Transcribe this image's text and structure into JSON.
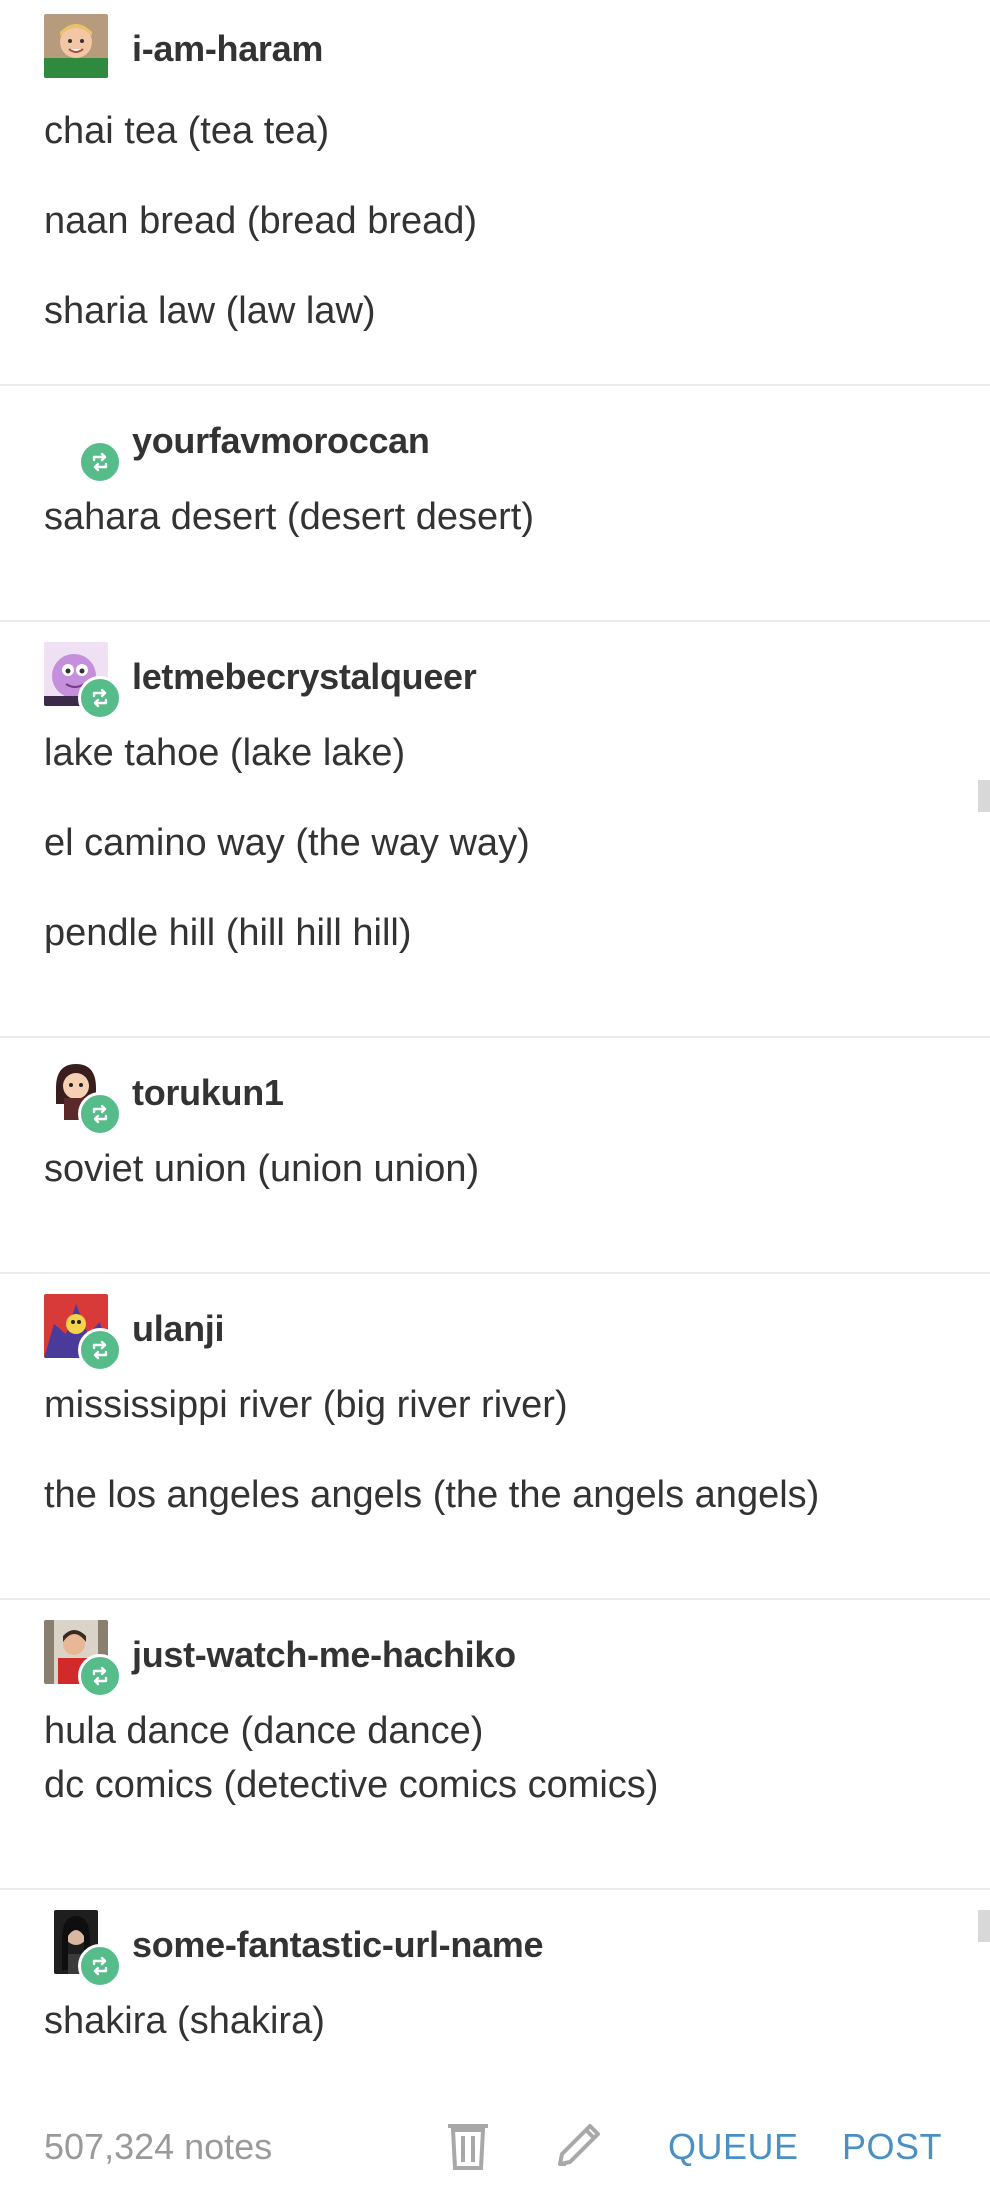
{
  "posts": [
    {
      "username": "i-am-haram",
      "lines": [
        "chai tea (tea tea)",
        "naan bread (bread bread)",
        "sharia law (law law)"
      ]
    },
    {
      "username": "yourfavmoroccan",
      "lines": [
        "sahara desert (desert desert)"
      ]
    },
    {
      "username": "letmebecrystalqueer",
      "lines": [
        "lake tahoe (lake lake)",
        "el camino way (the way way)",
        "pendle hill (hill hill hill)"
      ]
    },
    {
      "username": "torukun1",
      "lines": [
        "soviet union (union union)"
      ]
    },
    {
      "username": "ulanji",
      "lines": [
        "mississippi river (big river river)",
        "the los angeles angels (the the angels angels)"
      ]
    },
    {
      "username": "just-watch-me-hachiko",
      "lines": [
        "hula dance (dance dance)",
        "dc comics (detective comics comics)"
      ]
    },
    {
      "username": "some-fantastic-url-name",
      "lines": [
        "shakira (shakira)"
      ]
    }
  ],
  "footer": {
    "notes": "507,324 notes",
    "queue_label": "QUEUE",
    "post_label": "POST",
    "delete_icon": "trash-icon",
    "edit_icon": "pencil-icon"
  },
  "colors": {
    "reblog_badge": "#56bc8a",
    "action_blue": "#4a90c4",
    "notes_gray": "#9a9a9a",
    "divider": "#ececec"
  }
}
